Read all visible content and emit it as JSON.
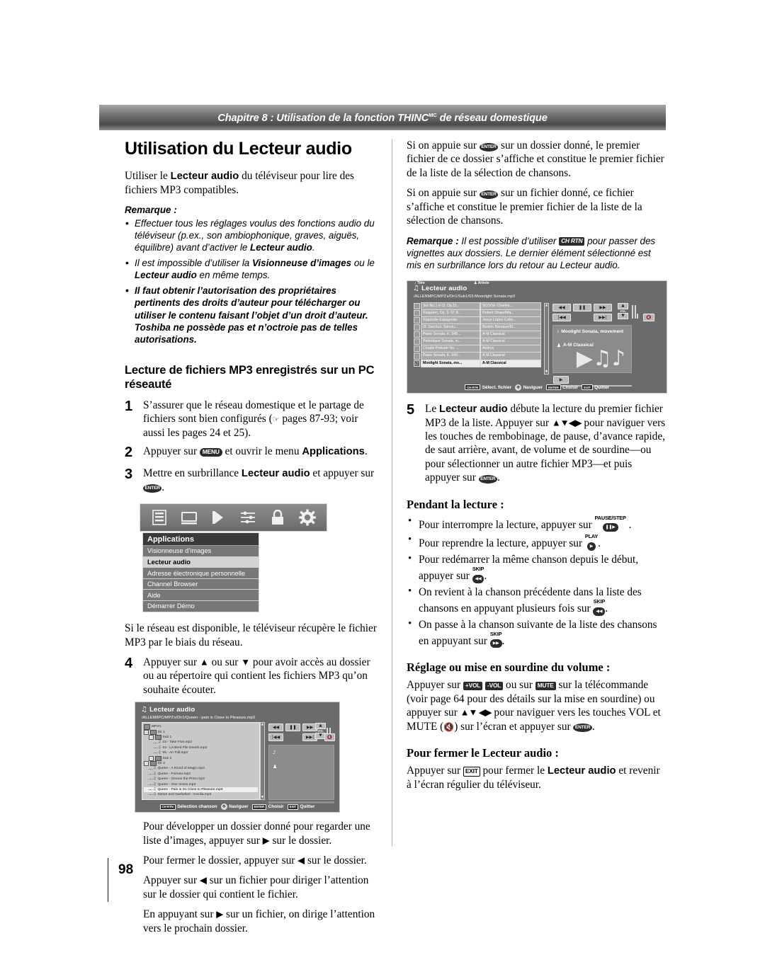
{
  "header": {
    "chapter_prefix": "Chapitre 8 : Utilisation de la fonction THINC",
    "chapter_tm": "MC",
    "chapter_suffix": " de réseau domestique"
  },
  "footer": {
    "page_number": "98"
  },
  "left_column": {
    "title": "Utilisation du Lecteur audio",
    "intro_a": "Utiliser le ",
    "intro_b": "Lecteur audio",
    "intro_c": " du téléviseur pour lire des fichiers MP3 compatibles.",
    "note_head": "Remarque :",
    "notes": [
      {
        "parts": [
          {
            "t": "Effectuer tous les réglages voulus des fonctions audio du téléviseur (p.ex., son ambiophonique, graves, aiguës, équilibre) avant d’activer le ",
            "b": false
          },
          {
            "t": "Lecteur audio",
            "b": true
          },
          {
            "t": ".",
            "b": false
          }
        ],
        "bold": false
      },
      {
        "parts": [
          {
            "t": "Il est impossible d’utiliser la ",
            "b": false
          },
          {
            "t": "Visionneuse d’images",
            "b": true
          },
          {
            "t": " ou le ",
            "b": false
          },
          {
            "t": "Lecteur audio",
            "b": true
          },
          {
            "t": " en même temps.",
            "b": false
          }
        ],
        "bold": false
      },
      {
        "parts": [
          {
            "t": "Il faut obtenir l’autorisation des propriétaires pertinents des droits d’auteur pour télécharger ou utiliser le contenu faisant l’objet d’un droit d’auteur. Toshiba ne possède pas et n’octroie pas de telles autorisations.",
            "b": false
          }
        ],
        "bold": true
      }
    ],
    "section_title": "Lecture de fichiers MP3 enregistrés sur un PC réseauté",
    "steps": [
      {
        "num": "1",
        "parts": [
          {
            "t": "S’assurer que le réseau domestique et le partage de fichiers sont bien configurés (",
            "k": null
          },
          {
            "t": "",
            "k": "hand"
          },
          {
            "t": " pages 87-93; voir aussi les pages 24 et 25).",
            "k": null
          }
        ]
      },
      {
        "num": "2",
        "parts": [
          {
            "t": "Appuyer sur ",
            "k": null
          },
          {
            "t": "MENU",
            "k": "oval"
          },
          {
            "t": " et ouvrir le menu ",
            "k": null
          },
          {
            "t": "Applications",
            "k": "bold"
          },
          {
            "t": ".",
            "k": null
          }
        ]
      },
      {
        "num": "3",
        "parts": [
          {
            "t": "Mettre en surbrillance ",
            "k": null
          },
          {
            "t": "Lecteur audio",
            "k": "bold"
          },
          {
            "t": " et appuyer sur ",
            "k": null
          },
          {
            "t": "ENTER",
            "k": "round"
          },
          {
            "t": ".",
            "k": null
          }
        ]
      }
    ],
    "after_shot_text": "Si le réseau est disponible, le téléviseur récupère le fichier MP3 par le biais du réseau.",
    "step4": {
      "num": "4",
      "parts": [
        {
          "t": "Appuyer sur ",
          "k": null
        },
        {
          "t": "▲",
          "k": "arr"
        },
        {
          "t": " ou sur ",
          "k": null
        },
        {
          "t": "▼",
          "k": "arr"
        },
        {
          "t": " pour avoir accès au dossier ou au répertoire qui contient les fichiers MP3 qu’on souhaite écouter.",
          "k": null
        }
      ]
    },
    "tail_paragraphs": [
      [
        {
          "t": "Pour développer un dossier donné pour regarder une liste d’images, appuyer sur ",
          "k": null
        },
        {
          "t": "▶",
          "k": "arr"
        },
        {
          "t": " sur le dossier.",
          "k": null
        }
      ],
      [
        {
          "t": "Pour fermer le dossier, appuyer sur ",
          "k": null
        },
        {
          "t": "◀",
          "k": "arr"
        },
        {
          "t": " sur le dossier.",
          "k": null
        }
      ],
      [
        {
          "t": "Appuyer sur ",
          "k": null
        },
        {
          "t": "◀",
          "k": "arr"
        },
        {
          "t": " sur un fichier pour diriger l’attention sur le dossier qui contient le fichier.",
          "k": null
        }
      ],
      [
        {
          "t": "En appuyant sur ",
          "k": null
        },
        {
          "t": "▶",
          "k": "arr"
        },
        {
          "t": " sur un fichier, on dirige l’attention vers le prochain dossier.",
          "k": null
        }
      ]
    ]
  },
  "right_column": {
    "paragraphs": [
      [
        {
          "t": "Si on appuie sur ",
          "k": null
        },
        {
          "t": "ENTER",
          "k": "round"
        },
        {
          "t": " sur un dossier donné, le premier fichier de ce dossier s’affiche et constitue le premier fichier de la liste de la sélection de chansons.",
          "k": null
        }
      ],
      [
        {
          "t": "Si on appuie sur ",
          "k": null
        },
        {
          "t": "ENTER",
          "k": "round"
        },
        {
          "t": " sur un fichier donné, ce fichier s’affiche et constitue le premier fichier de la liste de la sélection de chansons.",
          "k": null
        }
      ]
    ],
    "note_head": "Remarque :",
    "note_parts": [
      {
        "t": " Il est possible d’utiliser ",
        "k": null
      },
      {
        "t": "CH RTN",
        "k": "keysmall"
      },
      {
        "t": " pour passer des vignettes aux dossiers. Le dernier élément sélectionné est mis en surbrillance lors du retour au Lecteur audio.",
        "k": null
      }
    ],
    "step5": {
      "num": "5",
      "parts": [
        {
          "t": "Le ",
          "k": null
        },
        {
          "t": "Lecteur audio",
          "k": "bold"
        },
        {
          "t": " débute la lecture du premier fichier MP3 de la liste. Appuyer sur ",
          "k": null
        },
        {
          "t": "▲▼◀▶",
          "k": "arrows"
        },
        {
          "t": " pour naviguer vers les touches de rembobinage, de pause, d’avance rapide, de saut arrière, avant, de volume et de sourdine—ou pour sélectionner un autre fichier MP3—et puis appuyer sur ",
          "k": null
        },
        {
          "t": "ENTER",
          "k": "round"
        },
        {
          "t": ".",
          "k": null
        }
      ]
    },
    "during_playback_title": "Pendant la lecture :",
    "bullets": [
      [
        {
          "t": "Pour interrompre la lecture, appuyer sur ",
          "k": null
        },
        {
          "t": "PAUSE/STEP",
          "k": "stack",
          "glyph": "❚❚▶"
        },
        {
          "t": " .",
          "k": null
        }
      ],
      [
        {
          "t": "Pour reprendre la lecture, appuyer sur ",
          "k": null
        },
        {
          "t": "PLAY",
          "k": "stack",
          "glyph": "▶"
        },
        {
          "t": ".",
          "k": null
        }
      ],
      [
        {
          "t": "Pour redémarrer la même chanson depuis le début, appuyer sur ",
          "k": null
        },
        {
          "t": "SKIP",
          "k": "stack",
          "glyph": "◀◀"
        },
        {
          "t": ".",
          "k": null
        }
      ],
      [
        {
          "t": "On revient à la chanson précédente dans la liste des chansons en appuyant plusieurs fois sur ",
          "k": null
        },
        {
          "t": "SKIP",
          "k": "stack",
          "glyph": "◀◀"
        },
        {
          "t": ".",
          "k": null
        }
      ],
      [
        {
          "t": "On passe à la chanson suivante de la liste des chansons en appuyant sur ",
          "k": null
        },
        {
          "t": "SKIP",
          "k": "stack",
          "glyph": "▶▶"
        },
        {
          "t": ".",
          "k": null
        }
      ]
    ],
    "volume_title": "Réglage ou mise en sourdine du volume :",
    "volume_parts": [
      {
        "t": "Appuyer sur ",
        "k": null
      },
      {
        "t": "+VOL",
        "k": "keysmall2"
      },
      {
        "t": " ",
        "k": null
      },
      {
        "t": "-VOL",
        "k": "keysmall3"
      },
      {
        "t": " ou sur ",
        "k": null
      },
      {
        "t": "MUTE",
        "k": "keysmall"
      },
      {
        "t": " sur la télécommande (voir page 64 pour des détails sur la mise en sourdine) ou appuyer sur ",
        "k": null
      },
      {
        "t": "▲▼ ◀▶",
        "k": "arrows"
      },
      {
        "t": " pour naviguer vers les touches VOL et MUTE (",
        "k": null
      },
      {
        "t": "🔇",
        "k": "mute"
      },
      {
        "t": ") sur l’écran et appuyer sur ",
        "k": null
      },
      {
        "t": "ENTER",
        "k": "round"
      },
      {
        "t": ".",
        "k": null
      }
    ],
    "close_title": "Pour fermer le Lecteur audio :",
    "close_parts": [
      {
        "t": "Appuyer sur ",
        "k": null
      },
      {
        "t": "EXIT",
        "k": "outline"
      },
      {
        "t": " pour fermer le ",
        "k": null
      },
      {
        "t": "Lecteur audio",
        "k": "bold"
      },
      {
        "t": " et revenir à l’écran régulier du téléviseur.",
        "k": null
      }
    ]
  },
  "applications_shot": {
    "menu_header": "Applications",
    "icons": [
      "list-icon",
      "display-icon",
      "speaker-icon",
      "sliders-icon",
      "lock-icon",
      "gear-icon"
    ],
    "items": [
      {
        "label": "Visionneuse d’images",
        "selected": false
      },
      {
        "label": "Lecteur audio",
        "selected": true
      },
      {
        "label": "Adresse électronique personnelle",
        "selected": false
      },
      {
        "label": "Channel Browser",
        "selected": false
      },
      {
        "label": "Aide",
        "selected": false
      },
      {
        "label": "Démarrer Démo",
        "selected": false
      }
    ]
  },
  "player_shot_left": {
    "title": "Lecteur audio",
    "path": "/ALLEMIIPC/MP3's/Dir1/Queen - pain is Close to Pleasure.mp3",
    "tree": [
      {
        "depth": 0,
        "type": "folder",
        "label": "MP3's",
        "expander": "",
        "selected": false
      },
      {
        "depth": 0,
        "type": "folder",
        "label": "Dir 1",
        "expander": "-",
        "selected": false
      },
      {
        "depth": 1,
        "type": "folder",
        "label": "Sub 1",
        "expander": "-",
        "selected": false
      },
      {
        "depth": 2,
        "type": "file",
        "label": "03 - Take Five.mp3",
        "expander": "",
        "selected": false
      },
      {
        "depth": 2,
        "type": "file",
        "label": "04 - Lá Bred Flin Dtaoth.mp3",
        "expander": "",
        "selected": false
      },
      {
        "depth": 2,
        "type": "file",
        "label": "05 - An Túll.mp3",
        "expander": "",
        "selected": false
      },
      {
        "depth": 1,
        "type": "folder",
        "label": "Sub 2",
        "expander": "-",
        "selected": false
      },
      {
        "depth": 0,
        "type": "folder",
        "label": "Dir 2",
        "expander": "-",
        "selected": false
      },
      {
        "depth": 1,
        "type": "file",
        "label": "Queen - A Kinnd of Magic.mp3",
        "expander": "",
        "selected": false
      },
      {
        "depth": 1,
        "type": "file",
        "label": "Queen - Forever.mp3",
        "expander": "",
        "selected": false
      },
      {
        "depth": 1,
        "type": "file",
        "label": "Queen - Gimme the Prize.mp3",
        "expander": "",
        "selected": false
      },
      {
        "depth": 1,
        "type": "file",
        "label": "Queen - One Vision.mp3",
        "expander": "",
        "selected": false
      },
      {
        "depth": 1,
        "type": "file",
        "label": "Queen - Pain is So Close to Pleasure.mp3",
        "expander": "",
        "selected": true
      },
      {
        "depth": 1,
        "type": "file",
        "label": "Simon and Garfunkel - Cecilia.mp3",
        "expander": "",
        "selected": false
      }
    ],
    "controls": {
      "rewind": "◀◀",
      "pause": "❚❚",
      "forward": "▶▶",
      "skip_back": "|◀◀",
      "skip_fwd": "▶▶|",
      "vol_up": "▲",
      "vol_down": "▼",
      "vol_label": "VOL",
      "mute": "🔇"
    },
    "legend": {
      "key1": "CH RTN",
      "text1": "Sélection chanson",
      "dpad_text": "Naviguer",
      "key2": "ENTER",
      "text2": "Choisir",
      "key3": "EXIT",
      "text3": "Quitter"
    }
  },
  "player_shot_right": {
    "title": "Lecteur audio",
    "path": "/ALLENMPC/MP3's/Dir1/Sub1/03-Moonlight Sonata.mp3",
    "columns": {
      "title": "Titre",
      "artist": "Artiste"
    },
    "rows": [
      {
        "title": "Ser No.1 in D, Op.11..",
        "artist": "SCO/Sir Charles...",
        "selected": false,
        "playing": false
      },
      {
        "title": "Requiem, Op. 5: IV. R..",
        "artist": "Robert Shaw/Atla..",
        "selected": false,
        "playing": false
      },
      {
        "title": "Rapsodie Espagnole:..",
        "artist": "Jesus Lopez-Cobo...",
        "selected": false,
        "playing": false
      },
      {
        "title": "III. Sanctus: Sanctu...",
        "artist": "Boston Baroque/M...",
        "selected": false,
        "playing": false
      },
      {
        "title": "Piano Sonata, K. 545...",
        "artist": "A-M Classical",
        "selected": false,
        "playing": false
      },
      {
        "title": "Pathétique Sonata, m...",
        "artist": "A-M Classical",
        "selected": false,
        "playing": false
      },
      {
        "title": "Chopin Prelude No. ...",
        "artist": "Andrys",
        "selected": false,
        "playing": false
      },
      {
        "title": "Piano Sonata, K. 545...",
        "artist": "A-M Classical",
        "selected": false,
        "playing": false
      },
      {
        "title": "Moolight Sonata, mo...",
        "artist": "A-M Classical",
        "selected": true,
        "playing": true
      }
    ],
    "now_playing": {
      "track": "Moolight Sonata, movement",
      "artist": "A-M Classical"
    },
    "controls": {
      "rewind": "◀◀",
      "pause": "❚❚",
      "forward": "▶▶",
      "skip_back": "|◀◀",
      "skip_fwd": "▶▶|",
      "vol_up": "▲",
      "vol_down": "▼",
      "vol_label": "VOL",
      "mute": "🔇",
      "play": "▶"
    },
    "legend": {
      "key1": "CH RTN",
      "text1": "Sélect. fichier",
      "dpad_text": "Naviguer",
      "key2": "ENTER",
      "text2": "Choisir",
      "key3": "EXIT",
      "text3": "Quitter"
    }
  }
}
